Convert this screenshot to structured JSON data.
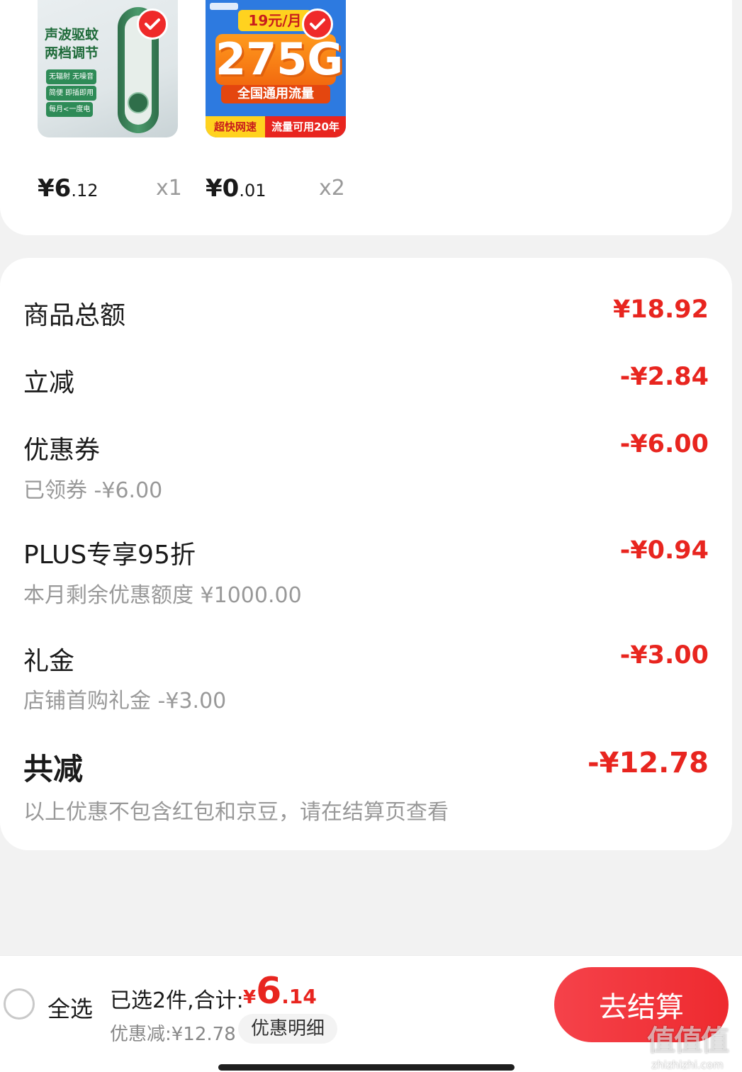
{
  "products": [
    {
      "image_text": {
        "line1": "声波驱蚊",
        "line2": "两档调节",
        "tags": [
          "无辐射 无噪音",
          "简便 即插即用",
          "每月<一度电"
        ]
      },
      "price_int": "¥6",
      "price_dec": ".12",
      "qty": "x1",
      "selected": true
    },
    {
      "image_text": {
        "top": "19元/月",
        "main": "275G",
        "sub": "全国通用流量",
        "bottom_left": "超快网速",
        "bottom_right": "流量可用20年"
      },
      "price_int": "¥0",
      "price_dec": ".01",
      "qty": "x2",
      "selected": true
    }
  ],
  "summary": {
    "goods_total_label": "商品总额",
    "goods_total_value": "¥18.92",
    "instant_cut_label": "立减",
    "instant_cut_value": "-¥2.84",
    "coupon_label": "优惠券",
    "coupon_value": "-¥6.00",
    "coupon_sub": "已领券 -¥6.00",
    "plus_label": "PLUS专享95折",
    "plus_value": "-¥0.94",
    "plus_sub": "本月剩余优惠额度 ¥1000.00",
    "gift_label": "礼金",
    "gift_value": "-¥3.00",
    "gift_sub": "店铺首购礼金 -¥3.00",
    "total_cut_label": "共减",
    "total_cut_value": "-¥12.78",
    "note": "以上优惠不包含红包和京豆，请在结算页查看"
  },
  "bottom_bar": {
    "select_all": "全选",
    "selected_text": "已选2件,合计:",
    "total_sym": "¥",
    "total_int": "6",
    "total_dec": ".14",
    "discount_text": "优惠减:¥12.78",
    "detail_button": "优惠明细",
    "checkout_button": "去结算"
  },
  "watermark": {
    "mark": "值值值",
    "url": "zhizhizhi.com"
  },
  "colors": {
    "accent": "#e8251f",
    "button": "#ef2a2f",
    "background": "#f2f2f2"
  }
}
